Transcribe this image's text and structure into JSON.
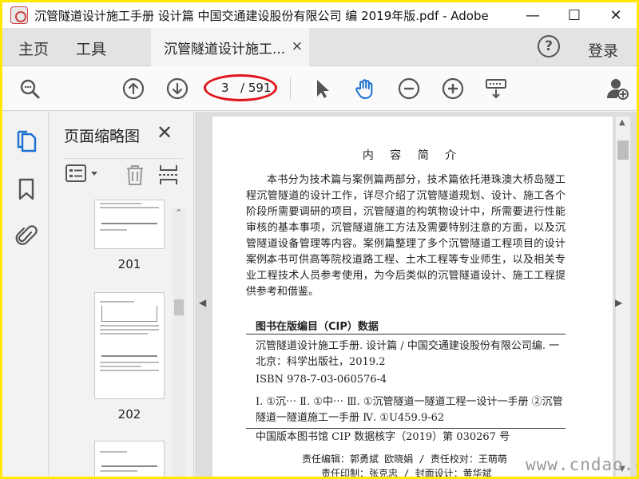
{
  "window": {
    "title": "沉管隧道设计施工手册 设计篇 中国交通建设股份有限公司 编 2019年版.pdf - Adobe",
    "minimize_glyph": "—",
    "maximize_glyph": "☐",
    "close_glyph": "✕"
  },
  "tabs": {
    "home": "主页",
    "tools": "工具",
    "document": "沉管隧道设计施工...",
    "document_close": "×",
    "help": "?",
    "login": "登录"
  },
  "toolbar": {
    "current_page": "3",
    "total_pages": "/ 591",
    "icons": [
      "zoom-search-icon",
      "page-up-icon",
      "page-down-icon",
      "pointer-icon",
      "hand-icon",
      "zoom-out-icon",
      "zoom-in-icon",
      "keyboard-scroll-icon",
      "add-user-icon"
    ],
    "highlight_color": "#e0151a"
  },
  "thumbnails": {
    "title": "页面缩略图",
    "close": "✕",
    "pages": [
      "201",
      "202"
    ]
  },
  "document": {
    "heading": "内 容 简 介",
    "paragraph_1": "本书分为技术篇与案例篇两部分，技术篇依托港珠澳大桥岛隧工程沉管隧道的设计工作，详尽介绍了沉管隧道规划、设计、施工各个阶段所需要调研的项目，沉管隧道的构筑物设计中，所需要进行性能审核的基本事项，沉管隧道施工方法及需要特别注意的方面，以及沉管隧道设备管理等内容。案例篇整理了多个沉管隧道工程项目的设计案例。",
    "paragraph_2": "本书可供高等院校道路工程、土木工程等专业师生，以及相关专业工程技术人员参考使用，为今后类似的沉管隧道设计、施工工程提供参考和借鉴。",
    "cip_title": "图书在版编目（CIP）数据",
    "cip_line_1": "沉管隧道设计施工手册. 设计篇 / 中国交通建设股份有限公司编. 一北京：科学出版社，2019.2",
    "isbn": "ISBN 978-7-03-060576-4",
    "classification": "Ⅰ. ①沉⋯ Ⅱ. ①中⋯ Ⅲ. ①沉管隧道一隧道工程一设计一手册 ②沉管隧道一隧道施工一手册 Ⅳ. ①U459.9-62",
    "cip_number": "中国版本图书馆 CIP 数据核字（2019）第 030267 号",
    "credit_1": "责任编辑：郭勇斌  欧晓娟 / 责任校对：王萌萌",
    "credit_2": "责任印制：张克忠 / 封面设计：黄华斌"
  },
  "watermark": "www.cndao.com"
}
